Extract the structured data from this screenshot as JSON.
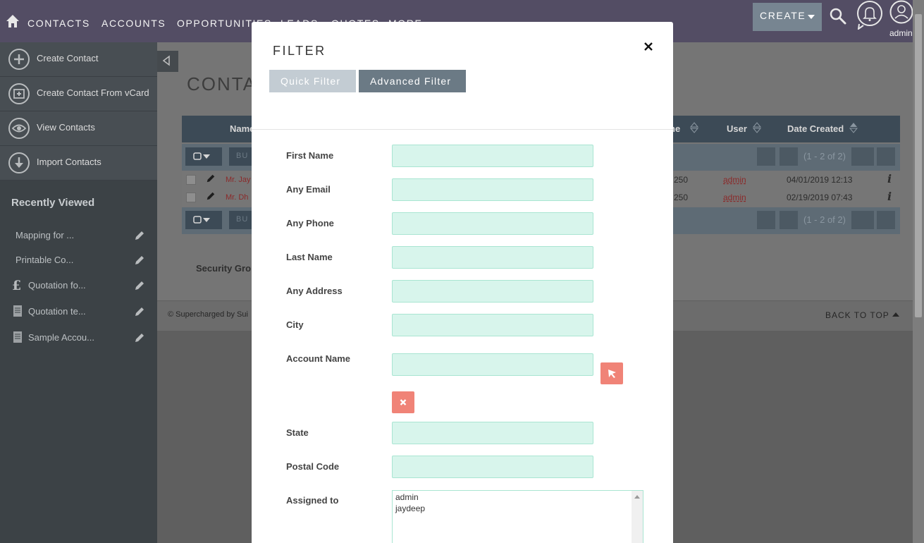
{
  "topnav": {
    "items": [
      "CONTACTS",
      "ACCOUNTS",
      "OPPORTUNITIES",
      "LEADS",
      "QUOTES",
      "MORE"
    ],
    "create_label": "CREATE",
    "user_name": "admin",
    "icons": [
      "home-icon",
      "search-icon",
      "bell-icon",
      "user-icon"
    ]
  },
  "sidebar": {
    "actions": [
      {
        "label": "Create Contact",
        "icon": "plus-circle-icon"
      },
      {
        "label": "Create Contact From vCard",
        "icon": "vcard-icon"
      },
      {
        "label": "View Contacts",
        "icon": "eye-icon"
      },
      {
        "label": "Import Contacts",
        "icon": "download-icon"
      }
    ],
    "recently_viewed_title": "Recently Viewed",
    "recent_items": [
      {
        "label": "Mapping for ...",
        "icon": ""
      },
      {
        "label": "Printable Co...",
        "icon": ""
      },
      {
        "label": "Quotation fo...",
        "icon": "pound-icon"
      },
      {
        "label": "Quotation te...",
        "icon": "document-icon"
      },
      {
        "label": "Sample Accou...",
        "icon": "document-icon"
      }
    ]
  },
  "page": {
    "title": "CONTA",
    "columns": {
      "name": "Name",
      "phone": "ne",
      "user": "User",
      "date_created": "Date Created"
    },
    "bulk_label": "BU",
    "pagination": "(1 - 2 of 2)",
    "rows": [
      {
        "name": "Mr. Jay",
        "phone": "250",
        "user": "admin",
        "date": "04/01/2019 12:13",
        "info": "i"
      },
      {
        "name": "Mr. Dh",
        "phone": "250",
        "user": "admin",
        "date": "02/19/2019 07:43",
        "info": "i"
      }
    ],
    "security_label": "Security Gro",
    "footer_text": "© Supercharged by Sui",
    "back_to_top": "BACK TO TOP"
  },
  "modal": {
    "title": "FILTER",
    "close_glyph": "×",
    "tabs": [
      {
        "label": "Quick Filter",
        "active": false
      },
      {
        "label": "Advanced Filter",
        "active": true
      }
    ],
    "fields": {
      "first_name": {
        "label": "First Name",
        "value": ""
      },
      "any_email": {
        "label": "Any Email",
        "value": ""
      },
      "any_phone": {
        "label": "Any Phone",
        "value": ""
      },
      "last_name": {
        "label": "Last Name",
        "value": ""
      },
      "any_address": {
        "label": "Any Address",
        "value": ""
      },
      "city": {
        "label": "City",
        "value": ""
      },
      "account_name": {
        "label": "Account Name",
        "value": ""
      },
      "state": {
        "label": "State",
        "value": ""
      },
      "postal_code": {
        "label": "Postal Code",
        "value": ""
      },
      "assigned_to": {
        "label": "Assigned to",
        "options": [
          "admin",
          "jaydeep"
        ]
      }
    }
  },
  "colors": {
    "nav_bg": "#534d64",
    "sidebar_bg": "#3c4246",
    "input_bg": "#d8f5ec",
    "input_border": "#a9e5d2",
    "accent_button": "#f08377",
    "tab_active": "#6b7a85",
    "tab_inactive": "#c3ccd3"
  }
}
